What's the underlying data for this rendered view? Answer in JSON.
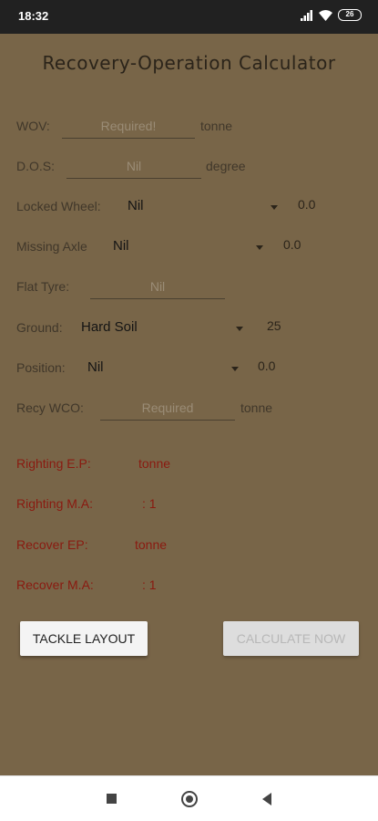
{
  "status_bar": {
    "time": "18:32",
    "battery": "26"
  },
  "title": "Recovery-Operation Calculator",
  "form": {
    "wov": {
      "label": "WOV:",
      "placeholder": "Required!",
      "unit": "tonne"
    },
    "dos": {
      "label": "D.O.S:",
      "placeholder": "Nil",
      "unit": "degree"
    },
    "locked_wheel": {
      "label": "Locked Wheel:",
      "value": "Nil",
      "number": "0.0"
    },
    "missing_axle": {
      "label": "Missing Axle",
      "value": "Nil",
      "number": "0.0"
    },
    "flat_tyre": {
      "label": "Flat Tyre:",
      "placeholder": "Nil"
    },
    "ground": {
      "label": "Ground:",
      "value": "Hard Soil",
      "number": "25"
    },
    "position": {
      "label": "Position:",
      "value": "Nil",
      "number": "0.0"
    },
    "recy_wco": {
      "label": "Recy WCO:",
      "placeholder": "Required",
      "unit": "tonne"
    }
  },
  "results": {
    "righting_ep": {
      "label": "Righting E.P:",
      "value": "tonne"
    },
    "righting_ma": {
      "label": "Righting M.A:",
      "value": ": 1"
    },
    "recover_ep": {
      "label": "Recover EP:",
      "value": "tonne"
    },
    "recover_ma": {
      "label": "Recover M.A:",
      "value": ": 1"
    }
  },
  "buttons": {
    "tackle_layout": "TACKLE LAYOUT",
    "calculate_now": "CALCULATE NOW"
  },
  "colors": {
    "background": "#786548",
    "result_text": "#8a1a10",
    "status_bar": "#212121"
  },
  "icons": {
    "status": [
      "signal-icon",
      "wifi-icon",
      "battery-icon"
    ],
    "nav": [
      "recent-apps-icon",
      "home-icon",
      "back-icon"
    ]
  }
}
